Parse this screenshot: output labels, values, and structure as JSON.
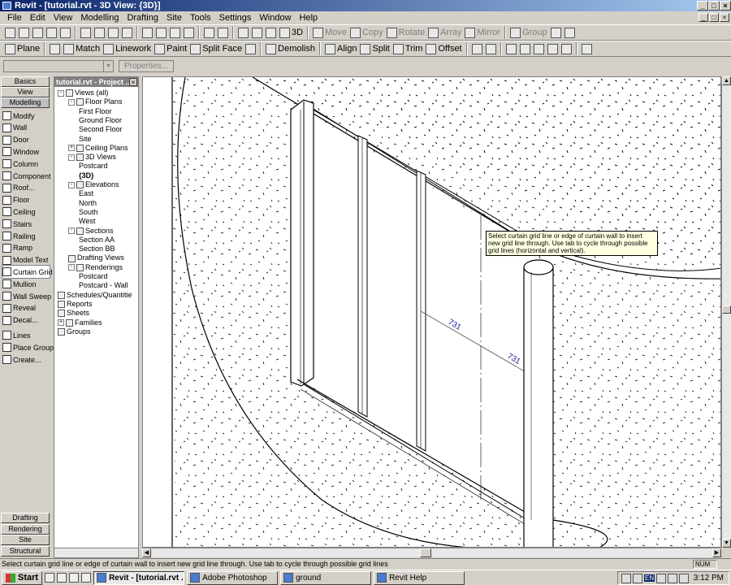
{
  "window": {
    "title": "Revit - [tutorial.rvt - 3D View: {3D}]"
  },
  "menu": [
    "File",
    "Edit",
    "View",
    "Modelling",
    "Drafting",
    "Site",
    "Tools",
    "Settings",
    "Window",
    "Help"
  ],
  "toolbar1": {
    "view3d": "3D",
    "move": "Move",
    "copy": "Copy",
    "rotate": "Rotate",
    "array": "Array",
    "mirror": "Mirror",
    "group": "Group"
  },
  "toolbar2": {
    "plane": "Plane",
    "match": "Match",
    "linework": "Linework",
    "paint": "Paint",
    "split_face": "Split Face",
    "demolish": "Demolish",
    "align": "Align",
    "split": "Split",
    "trim": "Trim",
    "offset": "Offset"
  },
  "typebar": {
    "type_value": "",
    "properties": "Properties..."
  },
  "designbar": {
    "top_tabs": [
      "Basics",
      "View",
      "Modelling"
    ],
    "items": [
      {
        "label": "Modify",
        "icon": "arrow-icon"
      },
      {
        "label": "Wall",
        "icon": "wall-icon"
      },
      {
        "label": "Door",
        "icon": "door-icon"
      },
      {
        "label": "Window",
        "icon": "window-icon"
      },
      {
        "label": "Column",
        "icon": "column-icon"
      },
      {
        "label": "Component",
        "icon": "component-icon"
      },
      {
        "label": "Roof...",
        "icon": "roof-icon"
      },
      {
        "label": "Floor",
        "icon": "floor-icon"
      },
      {
        "label": "Ceiling",
        "icon": "ceiling-icon"
      },
      {
        "label": "Stairs",
        "icon": "stairs-icon"
      },
      {
        "label": "Railing",
        "icon": "railing-icon"
      },
      {
        "label": "Ramp",
        "icon": "ramp-icon"
      },
      {
        "label": "Model Text",
        "icon": "text-icon"
      },
      {
        "label": "Curtain Grid",
        "icon": "curtain-grid-icon"
      },
      {
        "label": "Mullion",
        "icon": "mullion-icon"
      },
      {
        "label": "Wall Sweep",
        "icon": "wall-sweep-icon"
      },
      {
        "label": "Reveal",
        "icon": "reveal-icon"
      },
      {
        "label": "Decal...",
        "icon": "decal-icon"
      },
      {
        "label": "Lines",
        "icon": "lines-icon"
      },
      {
        "label": "Place Group",
        "icon": "group-icon"
      },
      {
        "label": "Create...",
        "icon": "create-icon"
      }
    ],
    "bottom_tabs": [
      "Drafting",
      "Rendering",
      "Site",
      "Structural"
    ]
  },
  "browser": {
    "title": "tutorial.rvt - Project ...",
    "tree": [
      {
        "label": "Views (all)",
        "level": 0,
        "toggle": "-"
      },
      {
        "label": "Floor Plans",
        "level": 1,
        "toggle": "-"
      },
      {
        "label": "First Floor",
        "level": 2
      },
      {
        "label": "Ground Floor",
        "level": 2
      },
      {
        "label": "Second Floor",
        "level": 2
      },
      {
        "label": "Site",
        "level": 2
      },
      {
        "label": "Ceiling Plans",
        "level": 1,
        "toggle": "+"
      },
      {
        "label": "3D Views",
        "level": 1,
        "toggle": "-"
      },
      {
        "label": "Postcard",
        "level": 2
      },
      {
        "label": "{3D}",
        "level": 2,
        "selected": true
      },
      {
        "label": "Elevations",
        "level": 1,
        "toggle": "-"
      },
      {
        "label": "East",
        "level": 2
      },
      {
        "label": "North",
        "level": 2
      },
      {
        "label": "South",
        "level": 2
      },
      {
        "label": "West",
        "level": 2
      },
      {
        "label": "Sections",
        "level": 1,
        "toggle": "-"
      },
      {
        "label": "Section AA",
        "level": 2
      },
      {
        "label": "Section BB",
        "level": 2
      },
      {
        "label": "Drafting Views",
        "level": 1
      },
      {
        "label": "Renderings",
        "level": 1,
        "toggle": "-"
      },
      {
        "label": "Postcard",
        "level": 2
      },
      {
        "label": "Postcard - Wall",
        "level": 2
      },
      {
        "label": "Schedules/Quantitie",
        "level": 0
      },
      {
        "label": "Reports",
        "level": 0
      },
      {
        "label": "Sheets",
        "level": 0
      },
      {
        "label": "Families",
        "level": 0,
        "toggle": "+"
      },
      {
        "label": "Groups",
        "level": 0
      }
    ]
  },
  "viewport": {
    "tooltip": "Select curtain grid line or edge of curtain wall to insert new grid line through.  Use tab to cycle through possible grid lines (horizontal and vertical).",
    "dim1": "731",
    "dim2": "731"
  },
  "status": {
    "text": "Select curtain grid line or edge of curtain wall to insert new grid line through.  Use tab to cycle through possible grid lines",
    "num": "NUM"
  },
  "taskbar": {
    "start": "Start",
    "tasks": [
      {
        "label": "Revit - [tutorial.rvt ...",
        "active": true
      },
      {
        "label": "Adobe Photoshop",
        "active": false
      },
      {
        "label": "ground",
        "active": false
      },
      {
        "label": "Revit Help",
        "active": false
      }
    ],
    "lang": "EN",
    "clock": "3:12 PM"
  }
}
